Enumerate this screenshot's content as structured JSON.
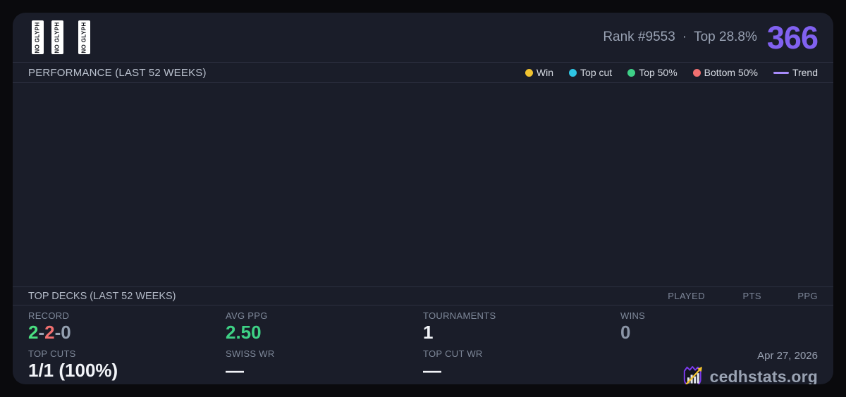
{
  "header": {
    "glyph_placeholders": [
      "NO GLYPH",
      "NO GLYPH",
      "NO GLYPH"
    ],
    "rank_label": "Rank #9553",
    "separator": "·",
    "percentile": "Top 28.8%",
    "score": "366",
    "score_color": "#8161f0"
  },
  "performance": {
    "title": "PERFORMANCE (LAST 52 WEEKS)",
    "legend": [
      {
        "label": "Win",
        "color": "#f1c330",
        "marker": "dot"
      },
      {
        "label": "Top cut",
        "color": "#2ec5e4",
        "marker": "dot"
      },
      {
        "label": "Top 50%",
        "color": "#3ecf87",
        "marker": "dot"
      },
      {
        "label": "Bottom 50%",
        "color": "#f17070",
        "marker": "dot"
      },
      {
        "label": "Trend",
        "color": "#a78bfa",
        "marker": "line"
      }
    ]
  },
  "top_decks": {
    "title": "TOP DECKS (LAST 52 WEEKS)",
    "columns": [
      "PLAYED",
      "PTS",
      "PPG"
    ]
  },
  "stats": {
    "record": {
      "label": "RECORD",
      "parts": [
        {
          "text": "2",
          "color": "#4ade80"
        },
        {
          "text": "-",
          "color": "#9aa3b2"
        },
        {
          "text": "2",
          "color": "#f17070"
        },
        {
          "text": "-",
          "color": "#9aa3b2"
        },
        {
          "text": "0",
          "color": "#94a0b0"
        }
      ]
    },
    "avg_ppg": {
      "label": "AVG PPG",
      "value": "2.50",
      "color": "#3ed185"
    },
    "tournaments": {
      "label": "TOURNAMENTS",
      "value": "1",
      "color": "#f2f4f8"
    },
    "wins": {
      "label": "WINS",
      "value": "0",
      "color": "#8b95a6"
    },
    "top_cuts": {
      "label": "TOP CUTS",
      "value": "1/1 (100%)",
      "color": "#f2f4f8"
    },
    "swiss_wr": {
      "label": "SWISS WR",
      "value": "—",
      "color": "#f2f4f8"
    },
    "top_cut_wr": {
      "label": "TOP CUT WR",
      "value": "—",
      "color": "#f2f4f8"
    }
  },
  "footer": {
    "date": "Apr 27, 2026",
    "brand": "cedhstats.org",
    "logo": "shield-barchart-arrow-icon",
    "logo_colors": {
      "shield": "#7c3aed",
      "bars": "#e2e6ee",
      "arrow": "#f2c230"
    }
  }
}
